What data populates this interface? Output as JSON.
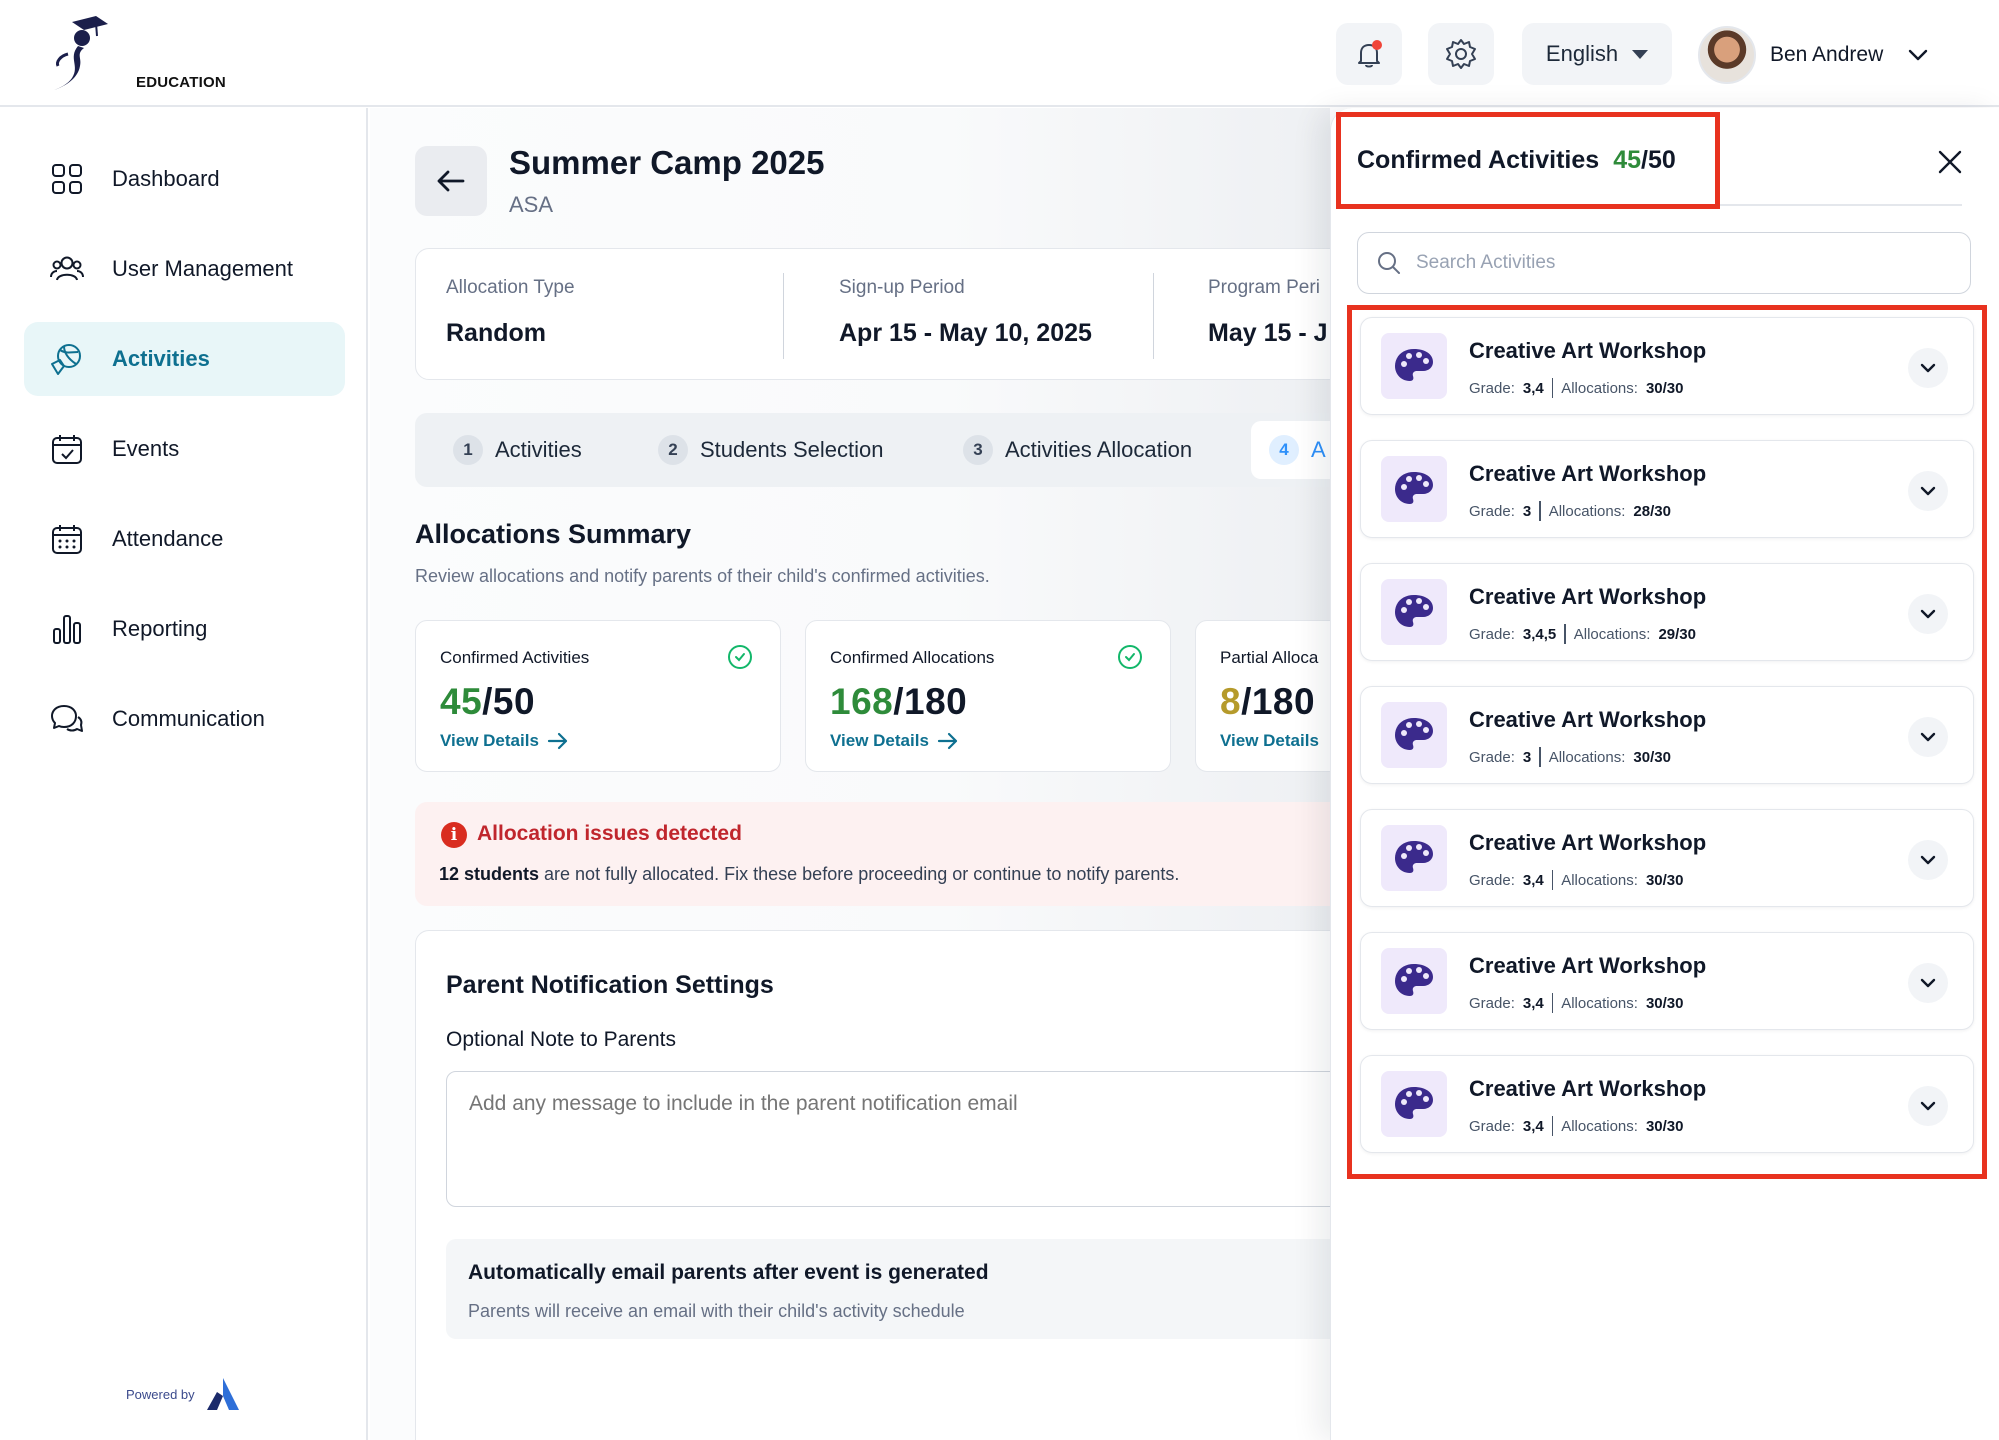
{
  "brand": {
    "logo_text": "EDUCATION",
    "powered_by": "Powered by"
  },
  "header": {
    "language": "English",
    "user_name": "Ben Andrew",
    "icons": [
      "bell-icon",
      "gear-icon",
      "chevron-down-icon"
    ]
  },
  "sidebar": {
    "items": [
      {
        "label": "Dashboard",
        "icon": "grid-icon",
        "active": false
      },
      {
        "label": "User Management",
        "icon": "users-icon",
        "active": false
      },
      {
        "label": "Activities",
        "icon": "activities-icon",
        "active": true
      },
      {
        "label": "Events",
        "icon": "calendar-check-icon",
        "active": false
      },
      {
        "label": "Attendance",
        "icon": "calendar-grid-icon",
        "active": false
      },
      {
        "label": "Reporting",
        "icon": "bar-chart-icon",
        "active": false
      },
      {
        "label": "Communication",
        "icon": "chat-bubbles-icon",
        "active": false
      }
    ]
  },
  "page": {
    "title": "Summer Camp 2025",
    "subtitle": "ASA",
    "info": [
      {
        "label": "Allocation Type",
        "value": "Random"
      },
      {
        "label": "Sign-up Period",
        "value": "Apr 15 - May 10, 2025"
      },
      {
        "label": "Program Peri",
        "value": "May 15 - J"
      }
    ],
    "steps": [
      {
        "num": "1",
        "label": "Activities"
      },
      {
        "num": "2",
        "label": "Students Selection"
      },
      {
        "num": "3",
        "label": "Activities Allocation"
      },
      {
        "num": "4",
        "label": "A"
      }
    ],
    "summary_title": "Allocations Summary",
    "summary_sub": "Review allocations and notify parents of their child's confirmed activities.",
    "stats": [
      {
        "label": "Confirmed Activities",
        "num": "45",
        "total": "/50",
        "link": "View Details"
      },
      {
        "label": "Confirmed Allocations",
        "num": "168",
        "total": "/180",
        "link": "View Details"
      },
      {
        "label": "Partial Alloca",
        "num": "8",
        "total": "/180",
        "link": "View Details"
      }
    ],
    "alert": {
      "title": "Allocation issues detected",
      "bold": "12 students",
      "text": " are not fully allocated. Fix these before proceeding or continue to notify parents."
    },
    "notification": {
      "title": "Parent Notification Settings",
      "note_label": "Optional Note to Parents",
      "note_placeholder": "Add any message to include in the parent notification email",
      "auto_title": "Automatically email parents after event is generated",
      "auto_sub": "Parents will receive an email with their child's activity schedule"
    }
  },
  "panel": {
    "title": "Confirmed Activities",
    "count_num": "45",
    "count_total": "/50",
    "search_placeholder": "Search Activities",
    "grade_label": "Grade:",
    "alloc_label": "Allocations:",
    "activities": [
      {
        "name": "Creative Art Workshop",
        "grade": "3,4",
        "allocations": "30/30"
      },
      {
        "name": "Creative Art Workshop",
        "grade": "3",
        "allocations": "28/30"
      },
      {
        "name": "Creative Art Workshop",
        "grade": "3,4,5",
        "allocations": "29/30"
      },
      {
        "name": "Creative Art Workshop",
        "grade": "3",
        "allocations": "30/30"
      },
      {
        "name": "Creative Art Workshop",
        "grade": "3,4",
        "allocations": "30/30"
      },
      {
        "name": "Creative Art Workshop",
        "grade": "3,4",
        "allocations": "30/30"
      },
      {
        "name": "Creative Art Workshop",
        "grade": "3,4",
        "allocations": "30/30"
      }
    ]
  },
  "colors": {
    "accent": "#0e7090",
    "success": "#2e8b3a",
    "partial": "#b59a2b",
    "danger": "#d92d20",
    "highlight": "#e8321f",
    "palette_icon": "#3b2a8c"
  }
}
